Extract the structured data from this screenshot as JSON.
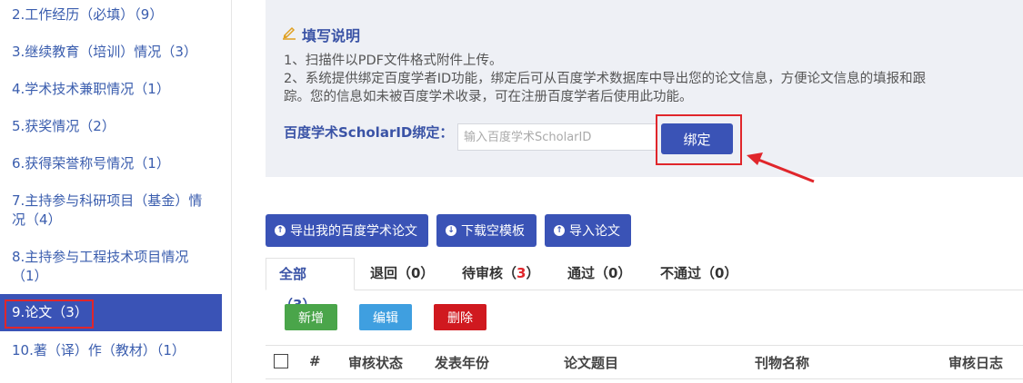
{
  "sidebar": {
    "items": [
      {
        "label": "2.工作经历（必填）（9）"
      },
      {
        "label": "3.继续教育（培训）情况（3）"
      },
      {
        "label": "4.学术技术兼职情况（1）"
      },
      {
        "label": "5.获奖情况（2）"
      },
      {
        "label": "6.获得荣誉称号情况（1）"
      },
      {
        "label": "7.主持参与科研项目（基金）情况（4）"
      },
      {
        "label": "8.主持参与工程技术项目情况（1）"
      },
      {
        "label": "9.论文（3）"
      },
      {
        "label": "10.著（译）作（教材）（1）"
      }
    ]
  },
  "info": {
    "title": "填写说明",
    "line1": "1、扫描件以PDF文件格式附件上传。",
    "line2": "2、系统提供绑定百度学者ID功能，绑定后可从百度学术数据库中导出您的论文信息，方便论文信息的填报和跟",
    "line3": "踪。您的信息如未被百度学术收录，可在注册百度学者后使用此功能。",
    "bind_label": "百度学术ScholarID绑定：",
    "bind_placeholder": "输入百度学术ScholarID",
    "bind_button": "绑定"
  },
  "actions": {
    "export": "导出我的百度学术论文",
    "download": "下载空模板",
    "import": "导入论文"
  },
  "tabs": {
    "all": "全部（",
    "all_count": "3",
    "all_close": "）",
    "returned": "退回（0）",
    "pending": "待审核（",
    "pending_count": "3",
    "pending_close": "）",
    "passed": "通过（0）",
    "failed": "不通过（0）"
  },
  "ops": {
    "add": "新增",
    "edit": "编辑",
    "delete": "删除"
  },
  "colors": {
    "add": "#4aa54a",
    "edit": "#3f9fe0",
    "delete": "#d0191f",
    "primary": "#3a53b6"
  },
  "table": {
    "headers": [
      "#",
      "审核状态",
      "发表年份",
      "论文题目",
      "刊物名称",
      "审核日志"
    ]
  }
}
